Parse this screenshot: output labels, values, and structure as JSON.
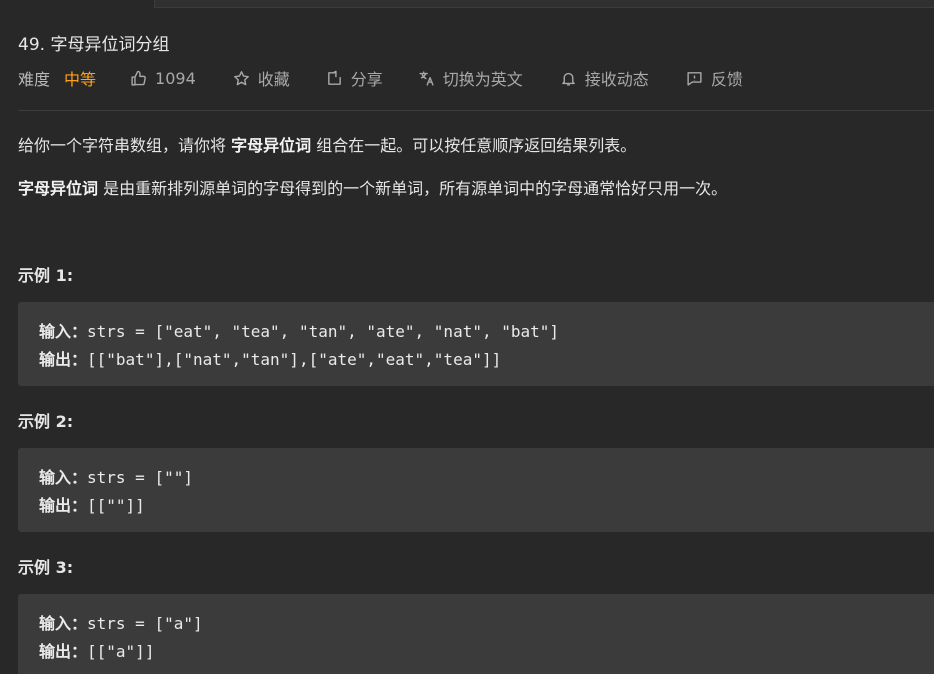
{
  "problem": {
    "title": "49. 字母异位词分组"
  },
  "meta": {
    "difficulty_label": "难度",
    "difficulty_value": "中等",
    "likes": "1094",
    "favorite": "收藏",
    "share": "分享",
    "translate": "切换为英文",
    "subscribe": "接收动态",
    "feedback": "反馈"
  },
  "description": {
    "p1_before": "给你一个字符串数组，请你将 ",
    "p1_bold": "字母异位词",
    "p1_after": " 组合在一起。可以按任意顺序返回结果列表。",
    "p2_bold": "字母异位词",
    "p2_after": " 是由重新排列源单词的字母得到的一个新单词，所有源单词中的字母通常恰好只用一次。"
  },
  "examples": [
    {
      "title": "示例 1:",
      "input_label": "输入：",
      "input_value": "strs = [\"eat\", \"tea\", \"tan\", \"ate\", \"nat\", \"bat\"]",
      "output_label": "输出：",
      "output_value": "[[\"bat\"],[\"nat\",\"tan\"],[\"ate\",\"eat\",\"tea\"]]"
    },
    {
      "title": "示例 2:",
      "input_label": "输入：",
      "input_value": "strs = [\"\"]",
      "output_label": "输出：",
      "output_value": "[[\"\"]]"
    },
    {
      "title": "示例 3:",
      "input_label": "输入：",
      "input_value": "strs = [\"a\"]",
      "output_label": "输出：",
      "output_value": "[[\"a\"]]"
    }
  ],
  "colors": {
    "background": "#282828",
    "difficulty_medium": "#ffa116",
    "code_background": "#3b3b3b"
  }
}
